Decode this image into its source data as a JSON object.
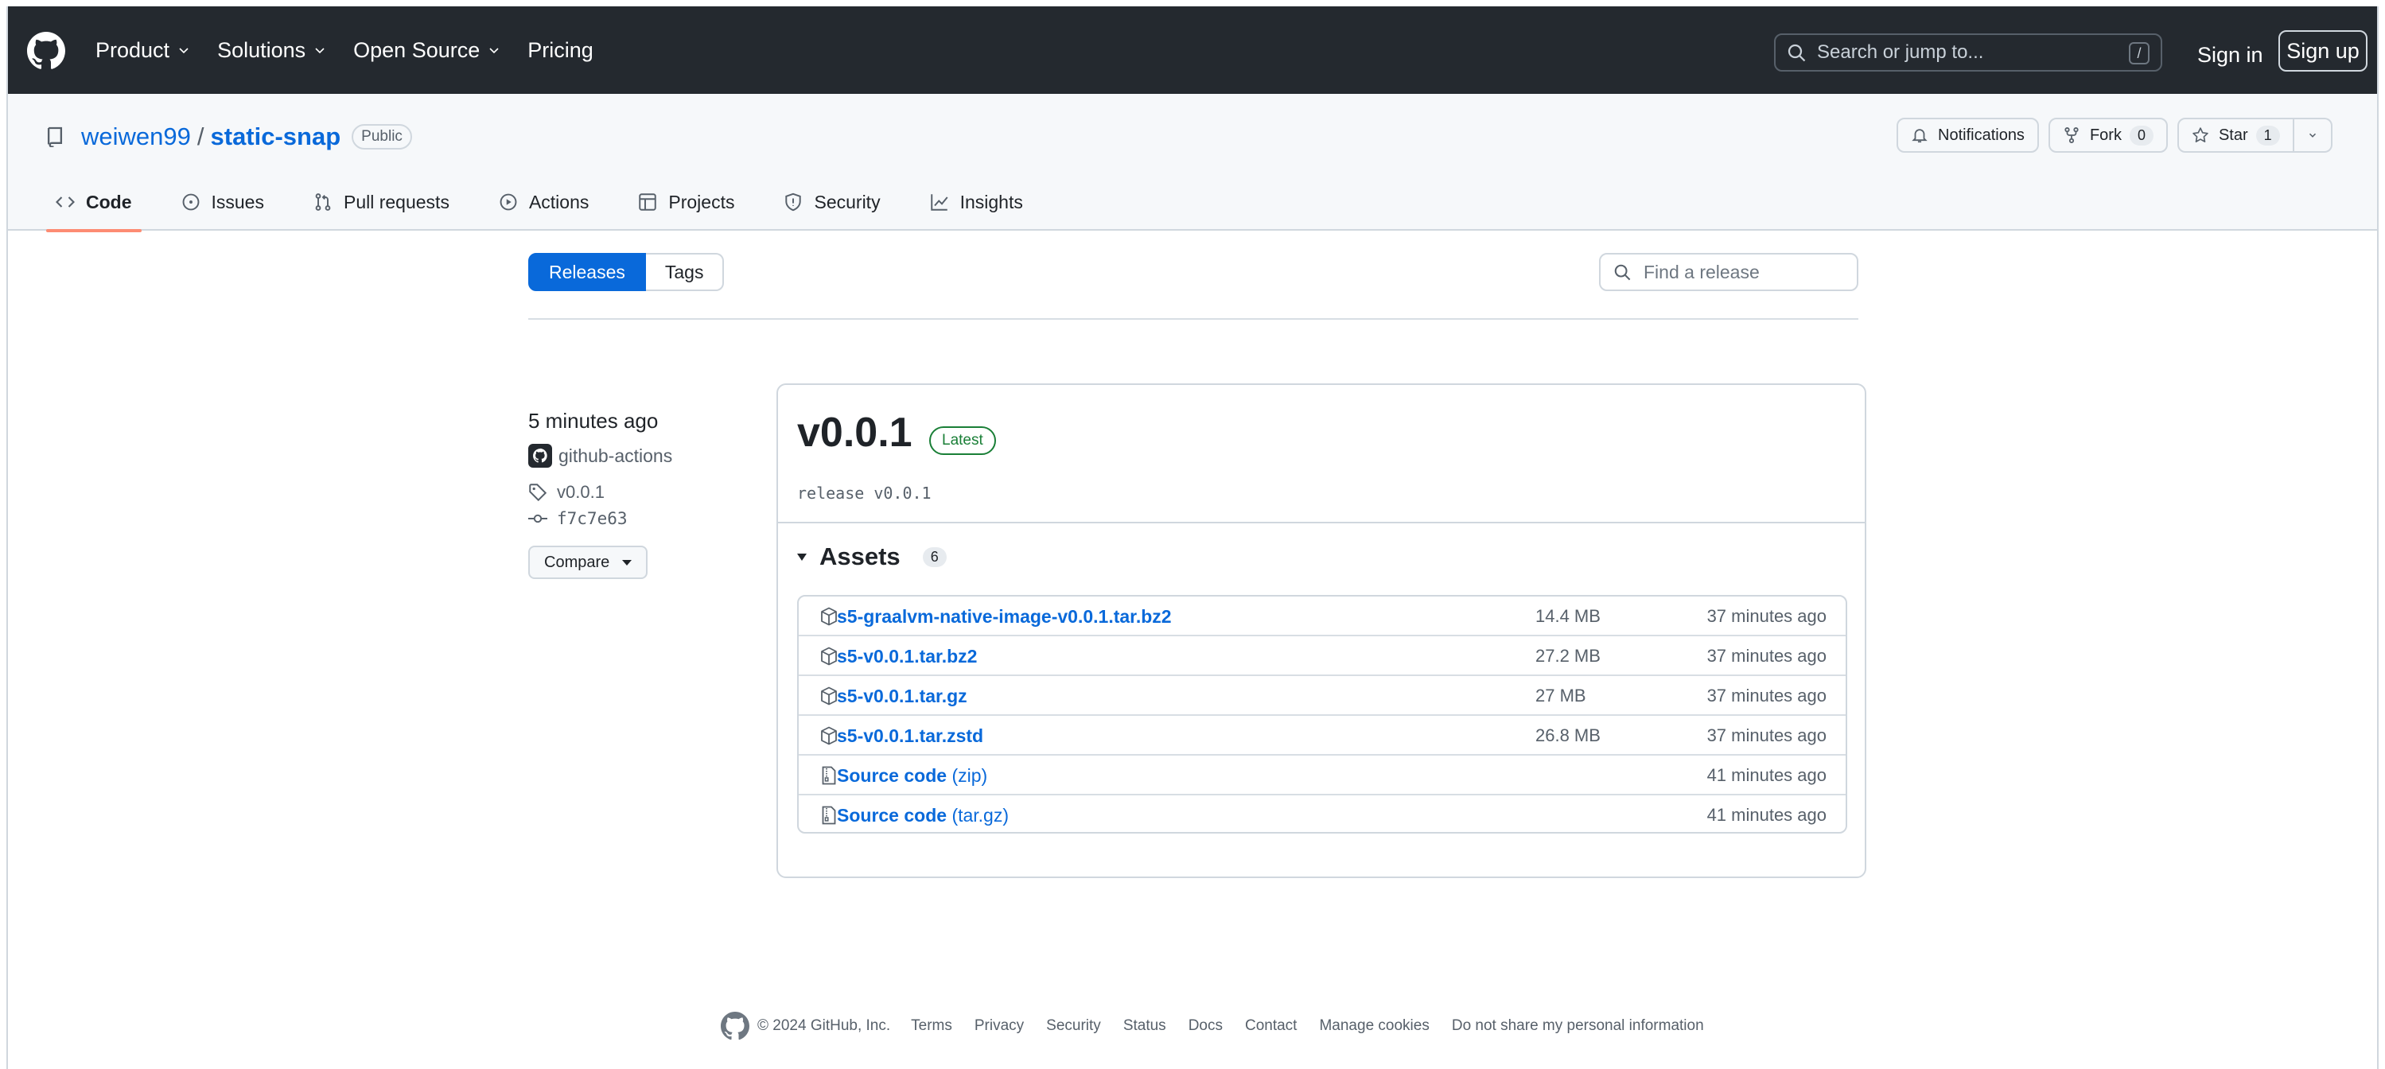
{
  "header": {
    "nav": [
      {
        "label": "Product",
        "has_menu": true
      },
      {
        "label": "Solutions",
        "has_menu": true
      },
      {
        "label": "Open Source",
        "has_menu": true
      },
      {
        "label": "Pricing",
        "has_menu": false
      }
    ],
    "search_placeholder": "Search or jump to...",
    "search_shortcut": "/",
    "sign_in": "Sign in",
    "sign_up": "Sign up"
  },
  "repo": {
    "owner": "weiwen99",
    "separator": "/",
    "name": "static-snap",
    "visibility": "Public",
    "notifications_label": "Notifications",
    "fork_label": "Fork",
    "fork_count": "0",
    "star_label": "Star",
    "star_count": "1",
    "tabs": [
      {
        "label": "Code",
        "icon": "code-icon",
        "active": true
      },
      {
        "label": "Issues",
        "icon": "issue-icon",
        "active": false
      },
      {
        "label": "Pull requests",
        "icon": "pull-request-icon",
        "active": false
      },
      {
        "label": "Actions",
        "icon": "play-icon",
        "active": false
      },
      {
        "label": "Projects",
        "icon": "table-icon",
        "active": false
      },
      {
        "label": "Security",
        "icon": "shield-icon",
        "active": false
      },
      {
        "label": "Insights",
        "icon": "graph-icon",
        "active": false
      }
    ]
  },
  "releases_toolbar": {
    "releases_label": "Releases",
    "tags_label": "Tags",
    "find_placeholder": "Find a release"
  },
  "release": {
    "time_ago": "5 minutes ago",
    "author": "github-actions",
    "tag": "v0.0.1",
    "commit": "f7c7e63",
    "compare_label": "Compare",
    "name": "v0.0.1",
    "badge": "Latest",
    "body": "release v0.0.1",
    "assets_title": "Assets",
    "assets_count": "6",
    "assets": [
      {
        "name": "s5-graalvm-native-image-v0.0.1.tar.bz2",
        "suffix": "",
        "size": "14.4 MB",
        "time": "37 minutes ago",
        "icon": "package-icon"
      },
      {
        "name": "s5-v0.0.1.tar.bz2",
        "suffix": "",
        "size": "27.2 MB",
        "time": "37 minutes ago",
        "icon": "package-icon"
      },
      {
        "name": "s5-v0.0.1.tar.gz",
        "suffix": "",
        "size": "27 MB",
        "time": "37 minutes ago",
        "icon": "package-icon"
      },
      {
        "name": "s5-v0.0.1.tar.zstd",
        "suffix": "",
        "size": "26.8 MB",
        "time": "37 minutes ago",
        "icon": "package-icon"
      },
      {
        "name": "Source code",
        "suffix": "(zip)",
        "size": "",
        "time": "41 minutes ago",
        "icon": "file-zip-icon"
      },
      {
        "name": "Source code",
        "suffix": "(tar.gz)",
        "size": "",
        "time": "41 minutes ago",
        "icon": "file-zip-icon"
      }
    ]
  },
  "footer": {
    "copyright": "© 2024 GitHub, Inc.",
    "links": [
      "Terms",
      "Privacy",
      "Security",
      "Status",
      "Docs",
      "Contact",
      "Manage cookies",
      "Do not share my personal information"
    ]
  },
  "colors": {
    "header_bg": "#24292f",
    "link": "#0969da",
    "accent_tab": "#fd8c73",
    "latest_green": "#1a7f37"
  }
}
